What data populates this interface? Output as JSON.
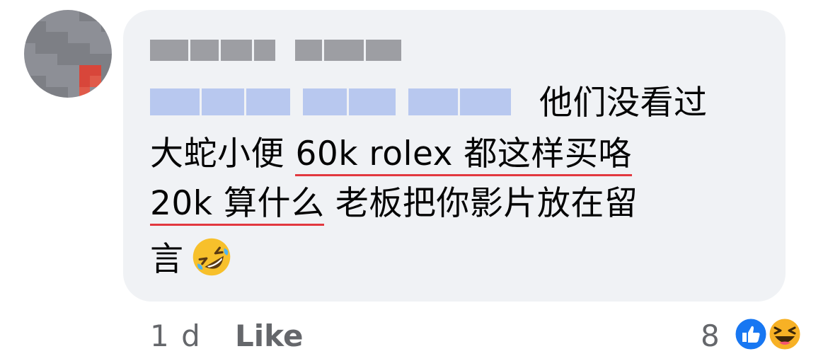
{
  "comment": {
    "line1_text": "他们没看过",
    "line2_plain": "大蛇小便 ",
    "line2_underlined": "60k rolex 都这样买咯",
    "line3_underlined": "20k 算什么",
    "line3_plain": " 老板把你影片放在留",
    "line4_text": "言",
    "emoji": "rolling-on-the-floor-laughing-icon"
  },
  "footer": {
    "time": "1 d",
    "like_label": "Like",
    "reaction_count": "8"
  },
  "colors": {
    "bubble": "#f0f2f5",
    "underline": "#e2383f",
    "meta_text": "#65676b",
    "like_blue": "#1877f2",
    "haha_yellow": "#f7b125"
  }
}
